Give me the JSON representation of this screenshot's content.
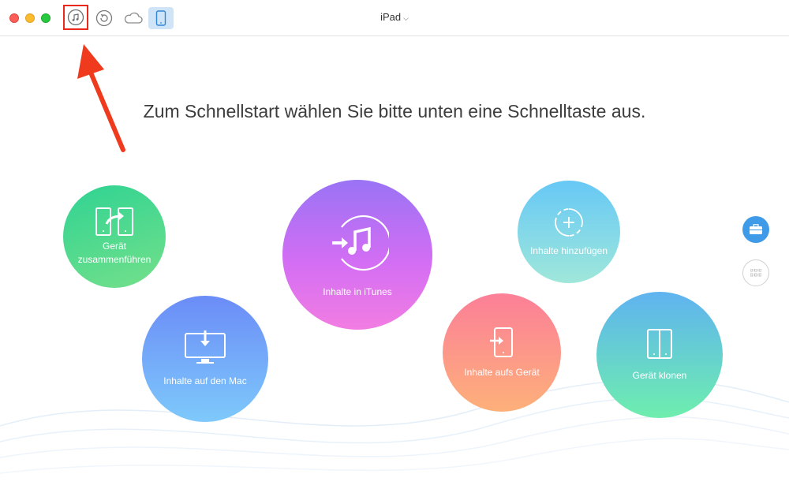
{
  "window": {
    "device_selector": "iPad",
    "toolbar": {
      "itunes_icon": "music-note-icon",
      "restore_icon": "restore-icon",
      "icloud_icon": "cloud-icon",
      "device_icon": "phone-icon"
    }
  },
  "main": {
    "headline": "Zum Schnellstart wählen Sie bitte unten eine Schnelltaste aus.",
    "actions": [
      {
        "label_line1": "Gerät",
        "label_line2": "zusammenführen",
        "icon": "merge-devices-icon"
      },
      {
        "label": "Inhalte auf den Mac",
        "icon": "monitor-download-icon"
      },
      {
        "label": "Inhalte in iTunes",
        "icon": "itunes-transfer-icon"
      },
      {
        "label": "Inhalte hinzufügen",
        "icon": "add-content-icon"
      },
      {
        "label": "Inhalte aufs Gerät",
        "icon": "device-import-icon"
      },
      {
        "label": "Gerät klonen",
        "icon": "clone-device-icon"
      }
    ]
  },
  "sidebar": {
    "toolkit_icon": "toolbox-icon",
    "grid_icon": "grid-icon"
  },
  "colors": {
    "highlight_box": "#e8291b",
    "arrow": "#f03a1e",
    "accent": "#3f9be8"
  }
}
